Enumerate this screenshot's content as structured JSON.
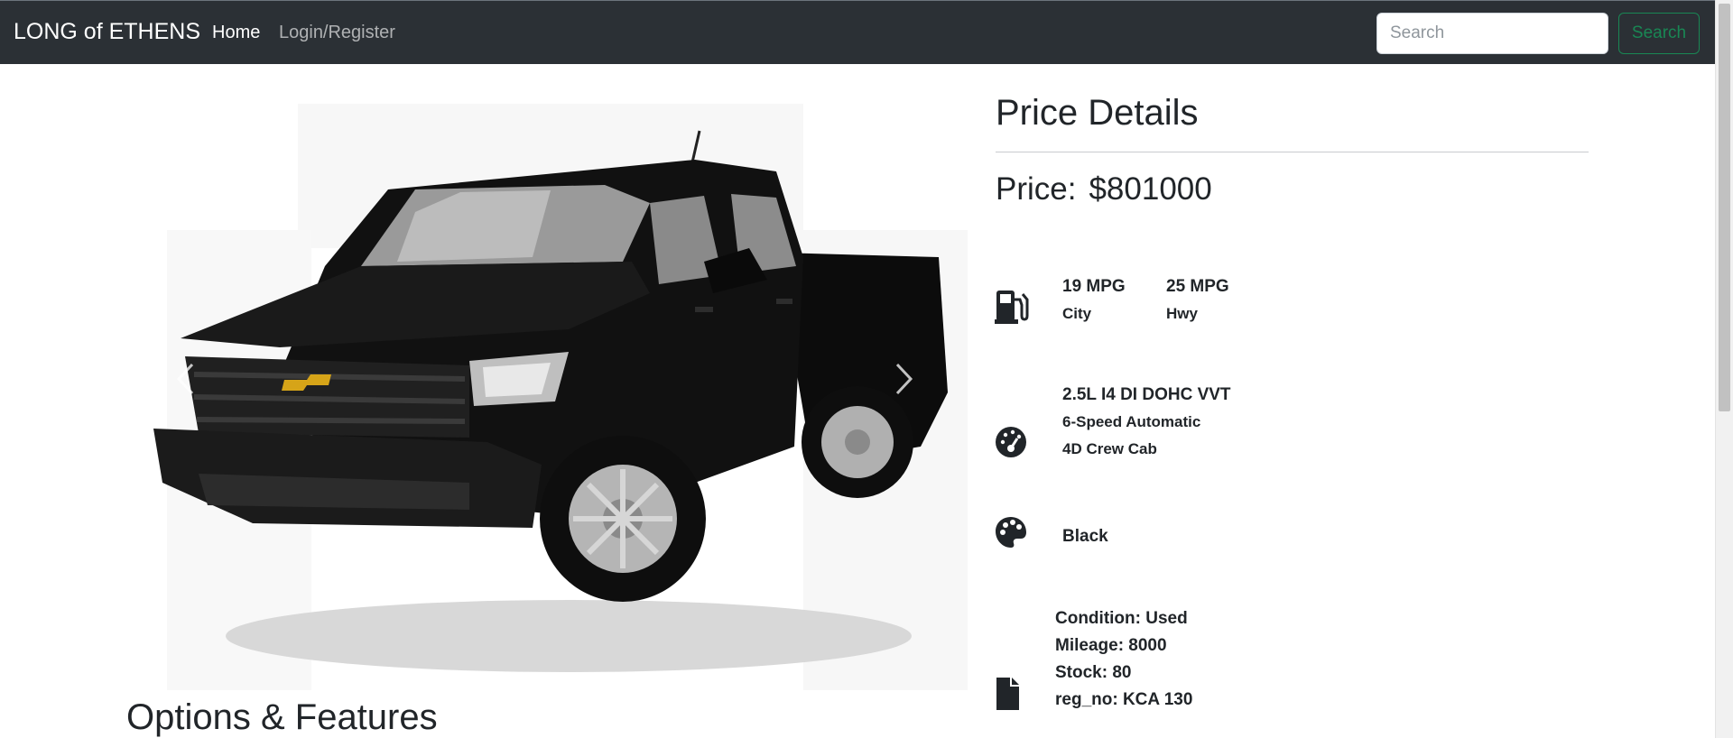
{
  "navbar": {
    "brand": "LONG of ETHENS",
    "links": [
      {
        "label": "Home"
      },
      {
        "label": "Login/Register"
      }
    ],
    "search_placeholder": "Search",
    "search_button": "Search"
  },
  "price_details": {
    "title": "Price Details",
    "price_label": "Price:",
    "price_value": "$801000"
  },
  "fuel": {
    "city_value": "19 MPG",
    "city_label": "City",
    "hwy_value": "25 MPG",
    "hwy_label": "Hwy"
  },
  "engine": {
    "engine": "2.5L I4 DI DOHC VVT",
    "transmission": "6-Speed Automatic",
    "body": "4D Crew Cab"
  },
  "color": {
    "value": "Black"
  },
  "details": {
    "condition": "Condition: Used",
    "mileage": "Mileage: 8000",
    "stock": "Stock: 80",
    "reg_no": "reg_no: KCA 130"
  },
  "options": {
    "title": "Options & Features"
  },
  "icons": {
    "fuel": "gas-pump-icon",
    "engine": "tachometer-icon",
    "color": "palette-icon",
    "details": "file-icon",
    "prev": "chevron-left-icon",
    "next": "chevron-right-icon"
  },
  "colors": {
    "navbar_bg": "#2b3035",
    "search_button": "#198754"
  }
}
